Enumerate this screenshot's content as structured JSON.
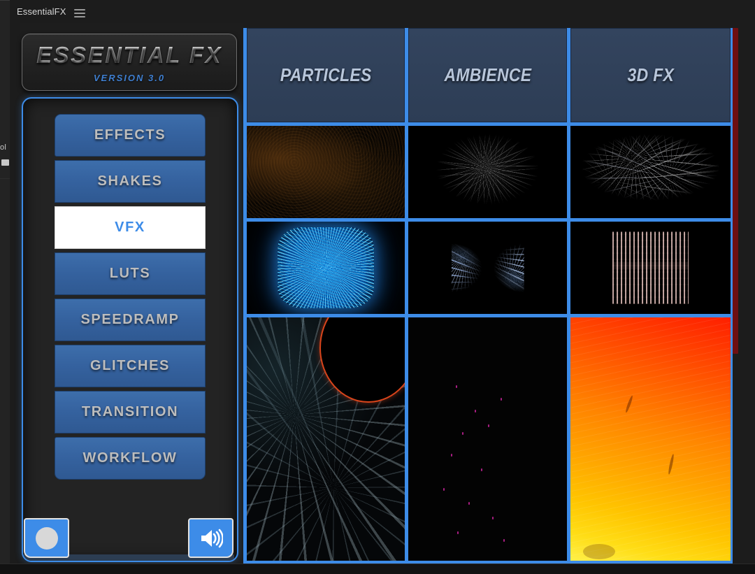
{
  "host": {
    "left_edge_text": "ol",
    "left_edge_icon": "panel-icon"
  },
  "titlebar": {
    "title": "EssentialFX",
    "menu_icon": "hamburger-menu-icon"
  },
  "logo": {
    "title": "ESSENTIAL FX",
    "version": "VERSION 3.0"
  },
  "sidebar": {
    "items": [
      {
        "label": "EFFECTS",
        "active": false
      },
      {
        "label": "SHAKES",
        "active": false
      },
      {
        "label": "VFX",
        "active": true
      },
      {
        "label": "LUTS",
        "active": false
      },
      {
        "label": "SPEEDRAMP",
        "active": false
      },
      {
        "label": "GLITCHES",
        "active": false
      },
      {
        "label": "TRANSITION",
        "active": false
      },
      {
        "label": "WORKFLOW",
        "active": false
      }
    ],
    "controls": {
      "record_icon": "record-circle-icon",
      "volume_icon": "speaker-volume-icon"
    }
  },
  "grid": {
    "columns": [
      {
        "label": "PARTICLES"
      },
      {
        "label": "AMBIENCE"
      },
      {
        "label": "3D FX"
      }
    ],
    "rows": [
      {
        "cells": [
          {
            "art": "dust-motes-preview",
            "column": "PARTICLES"
          },
          {
            "art": "snow-burst-preview",
            "column": "AMBIENCE"
          },
          {
            "art": "star-field-preview",
            "column": "3D FX"
          }
        ]
      },
      {
        "cells": [
          {
            "art": "plasma-orb-preview",
            "column": "PARTICLES"
          },
          {
            "art": "hourglass-particle-preview",
            "column": "AMBIENCE"
          },
          {
            "art": "glitch-grid-preview",
            "column": "3D FX"
          }
        ]
      },
      {
        "cells": [
          {
            "art": "eclipse-ring-preview",
            "column": "PARTICLES"
          },
          {
            "art": "dark-embers-preview",
            "column": "AMBIENCE"
          },
          {
            "art": "fire-gradient-preview",
            "column": "3D FX"
          }
        ]
      }
    ]
  },
  "scrollbar": {
    "name": "host-vertical-scrollbar"
  },
  "colors": {
    "accent_blue": "#3d8ce8",
    "button_blue": "#35629f",
    "header_tab": "#2e3f57",
    "panel_bg": "#1d1d1d",
    "scrollbar_red": "#6e0f12",
    "active_text_blue": "#3d8ce8"
  }
}
